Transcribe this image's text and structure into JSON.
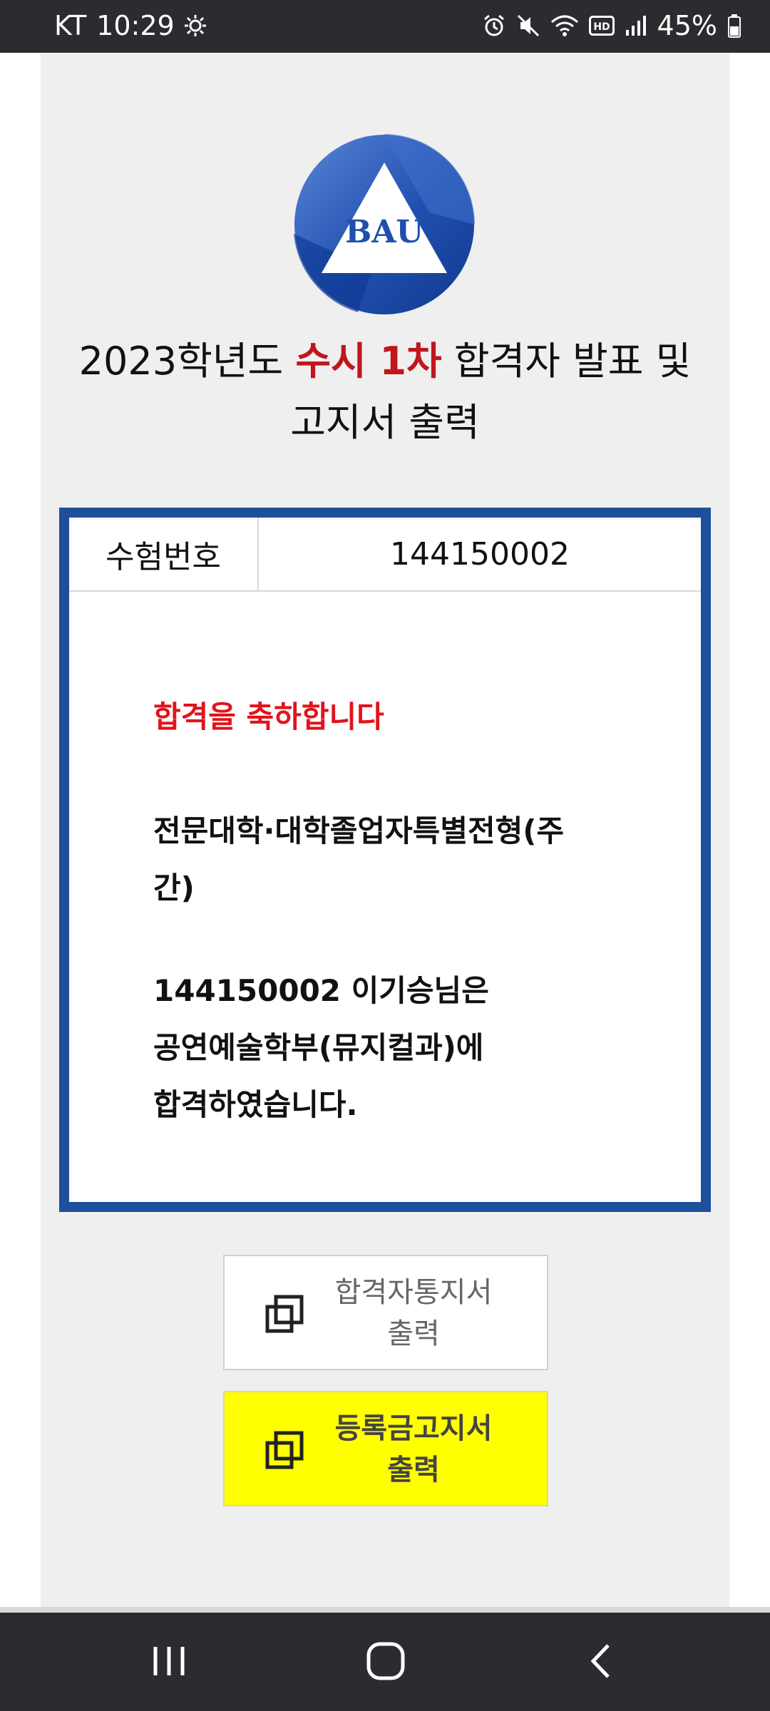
{
  "status_bar": {
    "carrier": "KT",
    "time": "10:29",
    "battery": "45%",
    "icons": [
      "brightness-icon",
      "alarm-icon",
      "mute-icon",
      "wifi-icon",
      "hd-icon",
      "signal-icon",
      "battery-icon"
    ]
  },
  "logo": {
    "text": "BAU"
  },
  "title": {
    "prefix": "2023학년도 ",
    "highlight": "수시 1차",
    "suffix": " 합격자 발표 및",
    "line2": "고지서 출력",
    "highlight_color": "#c0161c"
  },
  "result": {
    "exam_label": "수험번호",
    "exam_number": "144150002",
    "congrats": "합격을 축하합니다",
    "track_line1": "전문대학·대학졸업자특별전형(주",
    "track_line2": "간)",
    "result_line1": "144150002 이기승님은",
    "result_line2": "공연예술학부(뮤지컬과)에",
    "result_line3": "합격하였습니다.",
    "border_color": "#1e4f9c"
  },
  "buttons": {
    "notice_line1": "합격자통지서",
    "notice_line2": "출력",
    "fee_line1": "등록금고지서",
    "fee_line2": "출력",
    "fee_color": "#ffff00",
    "icon": "copy-window-icon"
  },
  "nav": {
    "icons": [
      "recent-apps-icon",
      "home-icon",
      "back-icon"
    ]
  }
}
